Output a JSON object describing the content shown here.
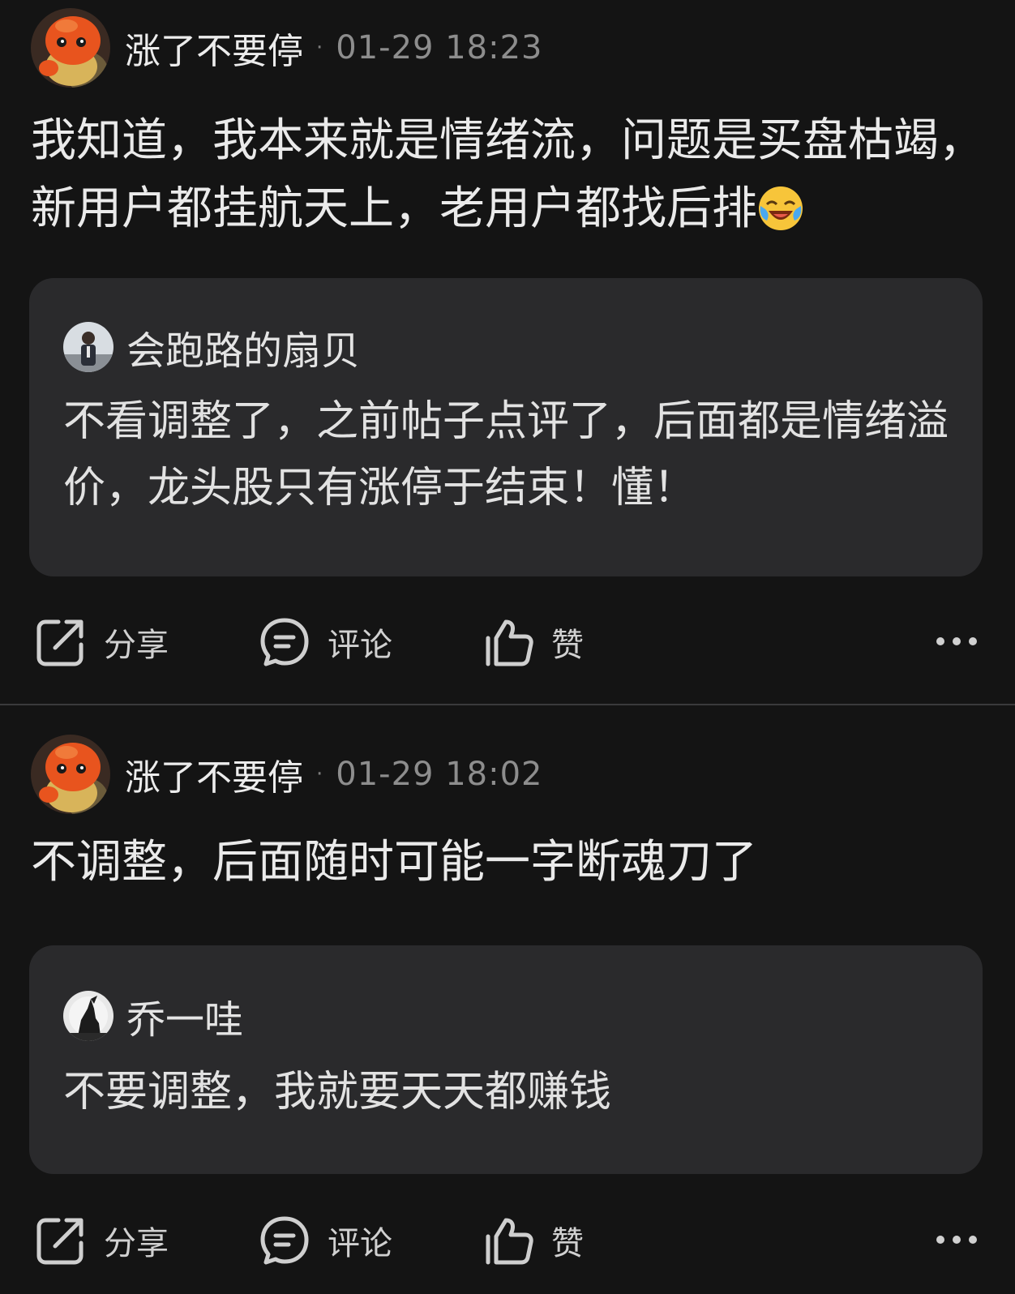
{
  "posts": [
    {
      "author": "涨了不要停",
      "separator": "·",
      "time": "01-29 18:23",
      "avatar_icon": "orange-mascot-avatar",
      "content": "我知道，我本来就是情绪流，问题是买盘枯竭，新用户都挂航天上，老用户都找后排",
      "content_emoji": "laughing-crying-emoji",
      "quote": {
        "author": "会跑路的扇贝",
        "avatar_icon": "person-photo-avatar",
        "text": "不看调整了，之前帖子点评了，后面都是情绪溢价，龙头股只有涨停于结束！懂！"
      },
      "actions": {
        "share": "分享",
        "comment": "评论",
        "like": "赞"
      }
    },
    {
      "author": "涨了不要停",
      "separator": "·",
      "time": "01-29 18:02",
      "avatar_icon": "orange-mascot-avatar",
      "content": "不调整，后面随时可能一字断魂刀了",
      "quote": {
        "author": "乔一哇",
        "avatar_icon": "howling-wolf-avatar",
        "text": "不要调整，我就要天天都赚钱"
      },
      "actions": {
        "share": "分享",
        "comment": "评论",
        "like": "赞"
      }
    }
  ],
  "colors": {
    "background": "#141414",
    "card": "#2a2a2c",
    "divider": "#3a3a3c",
    "text_primary": "#eaeaea",
    "text_secondary": "#8d8d8d"
  }
}
